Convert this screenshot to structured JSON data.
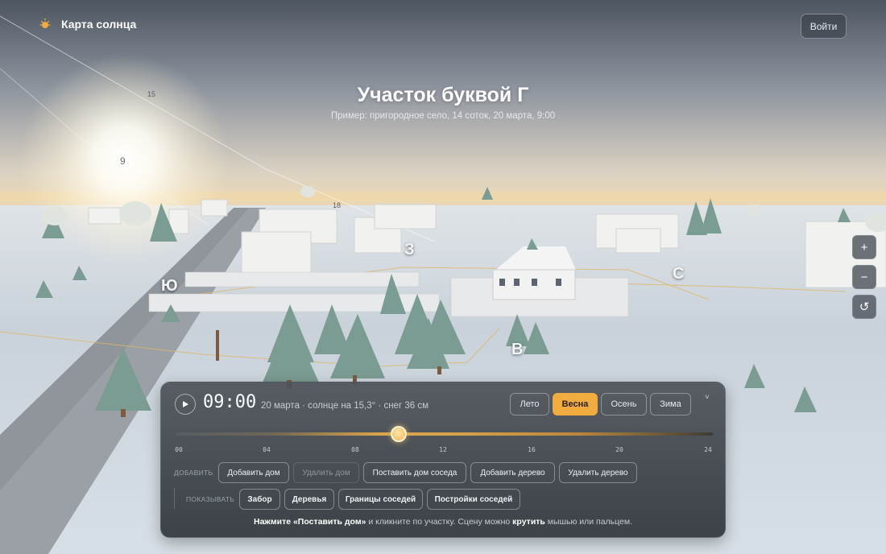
{
  "app": {
    "title": "Карта солнца",
    "login_label": "Войти",
    "logo_icon": "sun-icon"
  },
  "scene": {
    "title": "Участок буквой Г",
    "subtitle": "Пример: пригородное село, 14 соток, 20 марта, 9:00",
    "compass": {
      "west": "З",
      "south": "Ю",
      "east": "В",
      "north": "С"
    },
    "sun_hours": {
      "h9": "9",
      "h15": "15",
      "h18": "18"
    }
  },
  "map_controls": {
    "zoom_in": "+",
    "zoom_out": "−",
    "reset_icon": "reset-icon"
  },
  "panel": {
    "time": "09:00",
    "info": "20 марта · солнце на 15,3° · снег 36 см",
    "seasons": [
      {
        "label": "Лето",
        "active": false
      },
      {
        "label": "Весна",
        "active": true
      },
      {
        "label": "Осень",
        "active": false
      },
      {
        "label": "Зима",
        "active": false
      }
    ],
    "collapse": "˅",
    "slider": {
      "value_hours": 9,
      "min": 0,
      "max": 24
    },
    "ticks": [
      "00",
      "04",
      "08",
      "12",
      "16",
      "20",
      "24"
    ],
    "add_label": "ДОБАВИТЬ",
    "add_buttons": [
      {
        "label": "Добавить дом",
        "enabled": true
      },
      {
        "label": "Удалить дом",
        "enabled": false
      },
      {
        "label": "Поставить дом соседа",
        "enabled": true
      },
      {
        "label": "Добавить дерево",
        "enabled": true
      },
      {
        "label": "Удалить дерево",
        "enabled": true
      }
    ],
    "show_label": "ПОКАЗЫВАТЬ",
    "show_buttons": [
      {
        "label": "Забор"
      },
      {
        "label": "Деревья"
      },
      {
        "label": "Границы соседей"
      },
      {
        "label": "Постройки соседей"
      }
    ],
    "hint": {
      "part1": "Нажмите «Поставить дом»",
      "part2": " и кликните по участку. Сцену можно ",
      "part3": "крутить",
      "part4": " мышью или пальцем."
    }
  },
  "colors": {
    "accent": "#f0ac3f",
    "panel_bg": "#4a4f56"
  }
}
